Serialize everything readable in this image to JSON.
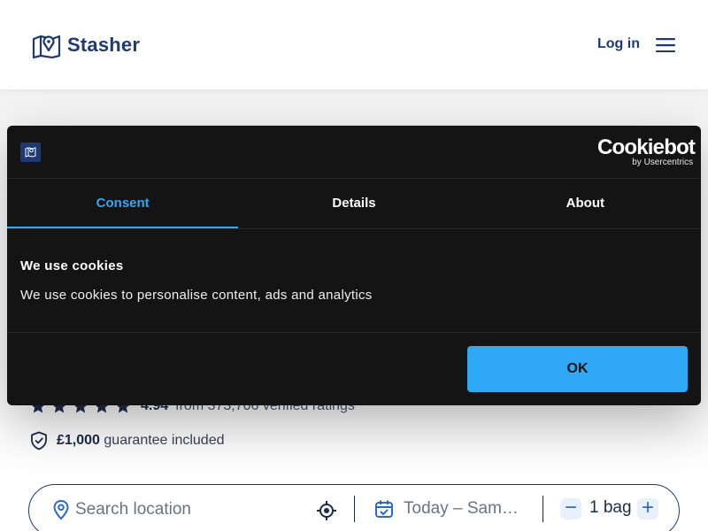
{
  "header": {
    "brand": "Stasher",
    "login_label": "Log in"
  },
  "ratings": {
    "score": "4.94",
    "text": "from 373,706 verified ratings",
    "stars": 5
  },
  "guarantee": {
    "amount": "£1,000",
    "text": "guarantee included"
  },
  "search": {
    "placeholder": "Search location",
    "date_value": "Today – Sam…",
    "bags_value": "1 bag",
    "minus_symbol": "−",
    "plus_symbol": "+"
  },
  "cookie": {
    "provider": "Cookiebot",
    "provider_sub": "by Usercentrics",
    "tabs": [
      {
        "label": "Consent",
        "active": true
      },
      {
        "label": "Details",
        "active": false
      },
      {
        "label": "About",
        "active": false
      }
    ],
    "heading": "We use cookies",
    "body": "We use cookies to personalise content, ads and analytics",
    "ok_label": "OK"
  },
  "colors": {
    "brand": "#1f3a73",
    "accent": "#2fa9f5",
    "dialog_bg": "#141414"
  }
}
